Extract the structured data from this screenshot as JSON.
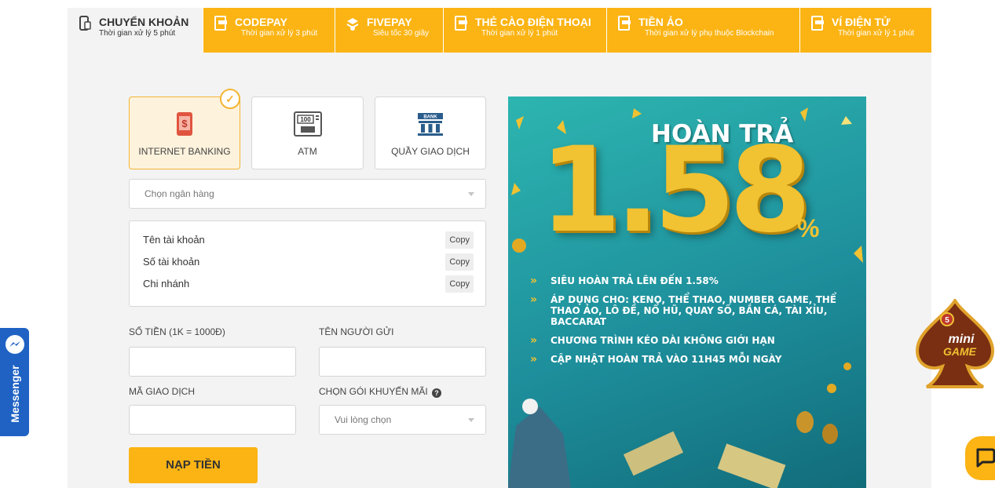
{
  "tabs": [
    {
      "name": "CHUYỂN KHOẢN",
      "sub": "Thời gian xử lý 5 phút",
      "icon": "mobile-bank-icon",
      "active": true
    },
    {
      "name": "CODEPAY",
      "sub": "Thời gian xử lý 3 phút",
      "icon": "card-icon"
    },
    {
      "name": "FIVEPAY",
      "sub": "Siêu tốc 30 giây",
      "icon": "stack-icon"
    },
    {
      "name": "THẺ CÀO ĐIỆN THOẠI",
      "sub": "Thời gian xử lý 1 phút",
      "icon": "card-icon"
    },
    {
      "name": "TIỀN ẢO",
      "sub": "Thời gian xử lý phụ thuộc Blockchain",
      "icon": "card-icon"
    },
    {
      "name": "VÍ ĐIỆN TỬ",
      "sub": "Thời gian xử lý 1 phút",
      "icon": "card-icon"
    }
  ],
  "methods": [
    {
      "label": "INTERNET BANKING",
      "icon": "internet-banking-icon",
      "selected": true
    },
    {
      "label": "ATM",
      "icon": "atm-icon",
      "icon_text": "100"
    },
    {
      "label": "QUẦY GIAO DỊCH",
      "icon": "bank-building-icon",
      "icon_text": "BANK"
    }
  ],
  "bank_select": {
    "placeholder": "Chọn ngân hàng"
  },
  "account_info": [
    {
      "label": "Tên tài khoản",
      "action": "Copy"
    },
    {
      "label": "Số tài khoản",
      "action": "Copy"
    },
    {
      "label": "Chi nhánh",
      "action": "Copy"
    }
  ],
  "form": {
    "amount_label": "SỐ TIỀN (1K = 1000Đ)",
    "sender_label": "TÊN NGƯỜI GỬI",
    "transaction_label": "MÃ GIAO DỊCH",
    "promo_label": "CHỌN GÓI KHUYẾN MÃI",
    "promo_placeholder": "Vui lòng chọn",
    "amount_value": "",
    "sender_value": "",
    "transaction_value": "",
    "submit_label": "NẠP TIỀN"
  },
  "banner": {
    "heading": "HOÀN TRẢ",
    "big_number": "1.58",
    "percent": "%",
    "bullets": [
      "SIÊU HOÀN TRẢ LÊN ĐẾN 1.58%",
      "ÁP DỤNG CHO: KENO, THỂ THAO, NUMBER GAME, THỂ THAO ẢO, LÔ ĐỀ, NỔ HŨ, QUAY SỐ, BẮN CÁ, TÀI XỈU, BACCARAT",
      "CHƯƠNG TRÌNH KÉO DÀI KHÔNG GIỚI HẠN",
      "CẬP NHẬT HOÀN TRẢ VÀO 11H45 MỖI NGÀY"
    ]
  },
  "floating": {
    "messenger": "Messenger",
    "mini_game_badge": "5",
    "mini_game_line1": "mini",
    "mini_game_line2": "GAME"
  },
  "colors": {
    "accent": "#fbb414",
    "panel": "#f3f3f3",
    "messenger": "#1f62c4"
  }
}
